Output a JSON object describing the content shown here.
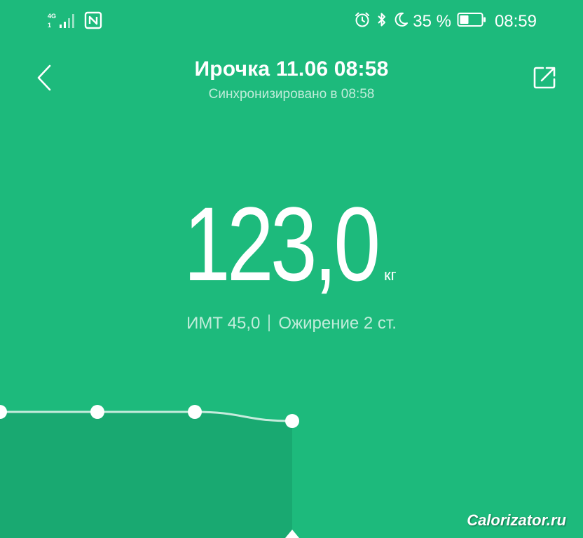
{
  "status_bar": {
    "network_type": "4G",
    "sim_slot": "1",
    "battery_percent": "35 %",
    "time": "08:59",
    "icons": [
      "signal-icon",
      "nfc-icon",
      "alarm-icon",
      "bluetooth-icon",
      "do-not-disturb-moon-icon",
      "battery-icon"
    ]
  },
  "header": {
    "back_icon": "chevron-left-icon",
    "share_icon": "share-external-icon",
    "title": "Ирочка 11.06 08:58",
    "subtitle": "Синхронизировано в 08:58"
  },
  "measurement": {
    "weight": "123,0",
    "unit": "кг",
    "bmi": "ИМТ 45,0",
    "status": "Ожирение 2 ст."
  },
  "chart_data": {
    "type": "line",
    "series": [
      {
        "values": [
          123.1,
          123.1,
          123.1,
          123.0
        ]
      }
    ],
    "highlighted_index": 3,
    "xlabel": "",
    "ylabel": ""
  },
  "colors": {
    "background": "#1dba7c",
    "foreground": "#ffffff",
    "chart_fill": "#1aa770"
  },
  "watermark": "Calorizator.ru"
}
